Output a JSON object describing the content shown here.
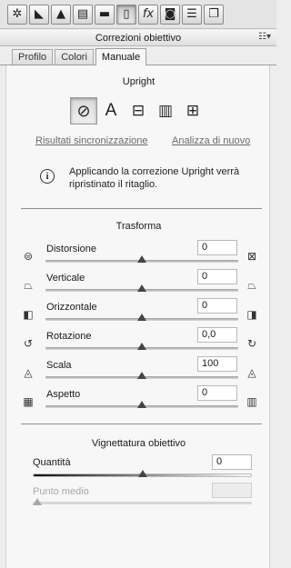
{
  "toolbar": {
    "icons": [
      "aperture-icon",
      "tone-curve-icon",
      "detail-icon",
      "hsl-icon",
      "split-toning-icon",
      "lens-corrections-icon",
      "fx-icon",
      "camera-calibration-icon",
      "presets-icon",
      "snapshots-icon"
    ],
    "glyphs": [
      "✲",
      "◣",
      "▲",
      "▤",
      "▬",
      "▯",
      "fx",
      "◙",
      "☰",
      "❐"
    ],
    "active_index": 5
  },
  "panel": {
    "title": "Correzioni obiettivo",
    "menu_glyph": "☷▾"
  },
  "tabs": [
    {
      "label": "Profilo"
    },
    {
      "label": "Colori"
    },
    {
      "label": "Manuale"
    }
  ],
  "upright": {
    "title": "Upright",
    "buttons": [
      {
        "name": "off",
        "glyph": "⊘"
      },
      {
        "name": "auto",
        "glyph": "A"
      },
      {
        "name": "level",
        "glyph": "⊟"
      },
      {
        "name": "vertical",
        "glyph": "▥"
      },
      {
        "name": "full",
        "glyph": "⊞"
      }
    ],
    "sync_link": "Risultati sincronizzazione",
    "reanalyze_link": "Analizza di nuovo",
    "info_glyph": "i",
    "info_text": "Applicando la correzione Upright verrà ripristinato il ritaglio."
  },
  "transform": {
    "title": "Trasforma",
    "sliders": [
      {
        "label": "Distorsione",
        "value": "0",
        "level": 0.5,
        "icon_left": "⊜",
        "icon_right": "⊠"
      },
      {
        "label": "Verticale",
        "value": "0",
        "level": 0.5,
        "icon_left": "⏢",
        "icon_right": "⏢"
      },
      {
        "label": "Orizzontale",
        "value": "0",
        "level": 0.5,
        "icon_left": "◧",
        "icon_right": "◨"
      },
      {
        "label": "Rotazione",
        "value": "0,0",
        "level": 0.5,
        "icon_left": "↺",
        "icon_right": "↻"
      },
      {
        "label": "Scala",
        "value": "100",
        "level": 0.5,
        "icon_left": "◬",
        "icon_right": "◬"
      },
      {
        "label": "Aspetto",
        "value": "0",
        "level": 0.5,
        "icon_left": "▦",
        "icon_right": "▥"
      }
    ]
  },
  "vignetting": {
    "title": "Vignettatura obiettivo",
    "amount_label": "Quantità",
    "amount_value": "0",
    "amount_level": 0.5,
    "midpoint_label": "Punto medio",
    "midpoint_value": "",
    "midpoint_level": 0.0
  }
}
